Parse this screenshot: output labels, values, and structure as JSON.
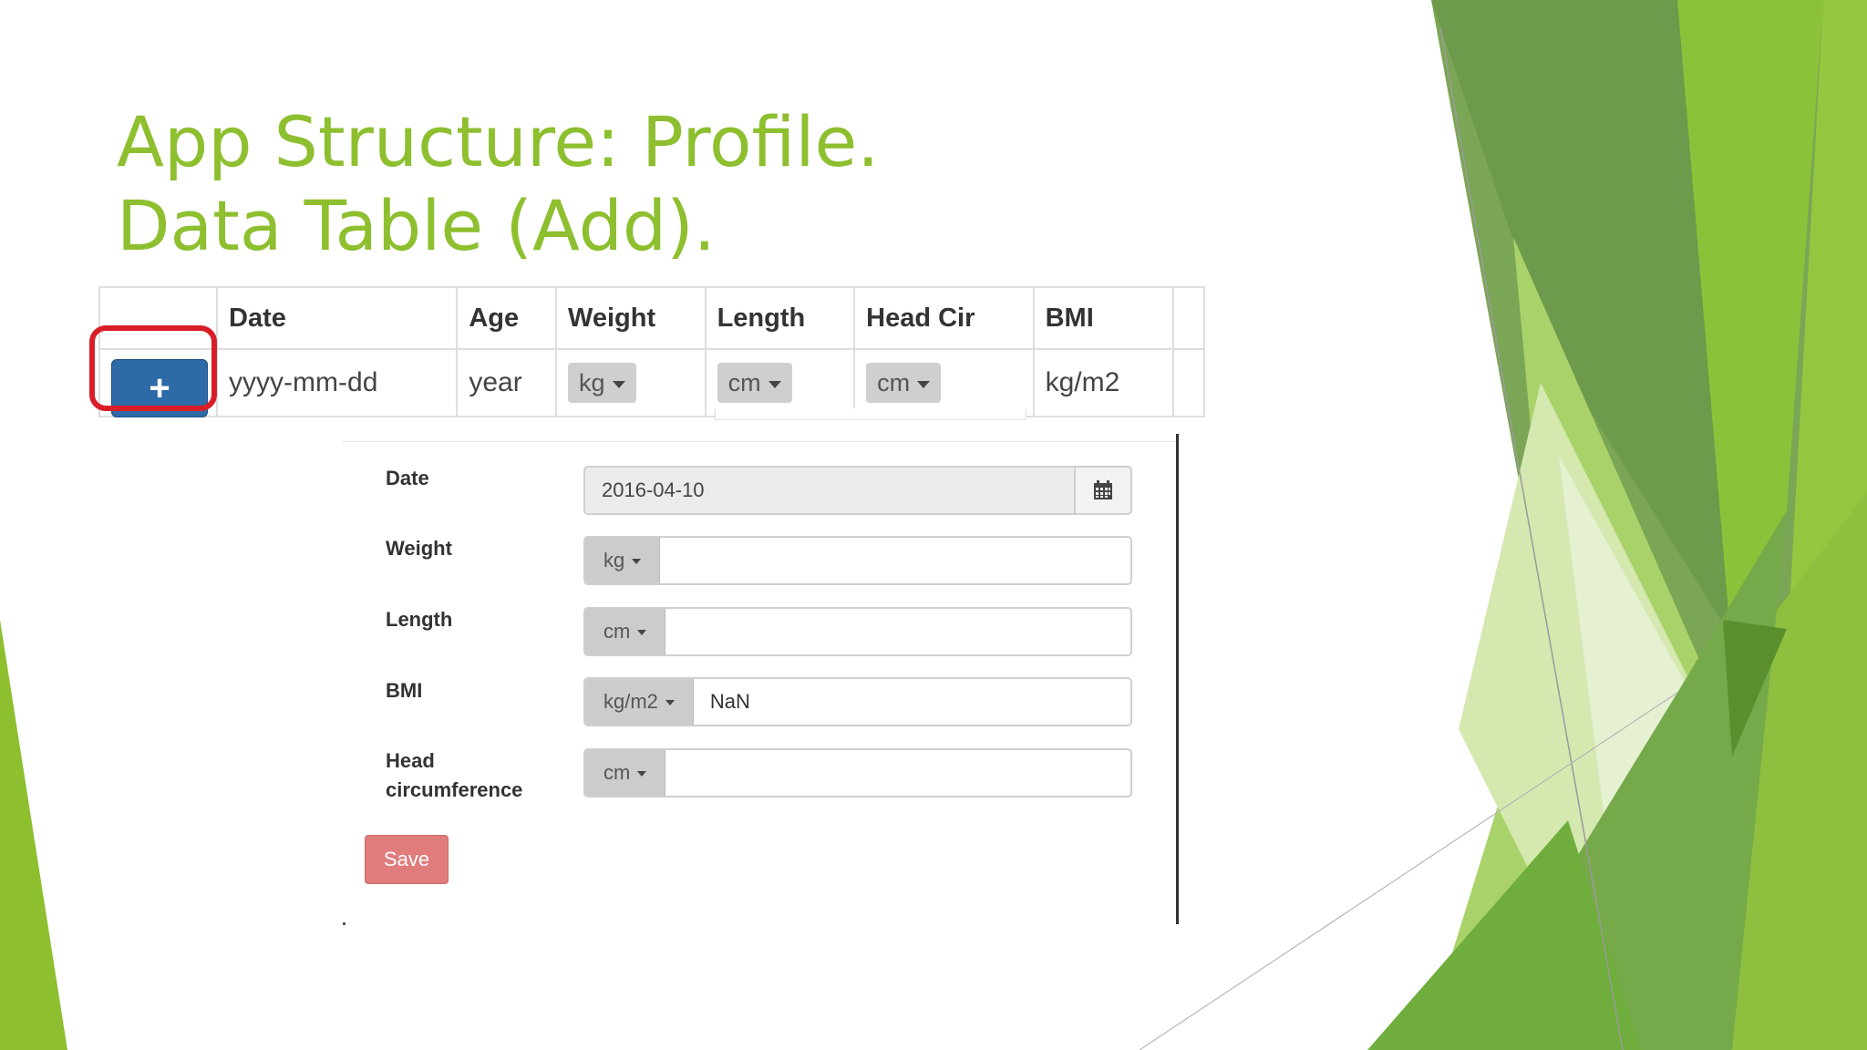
{
  "slide": {
    "title_line1": "App Structure: Profile.",
    "title_line2": "Data Table (Add).",
    "accent_color": "#8dbf2f",
    "highlight_color": "#d91e27"
  },
  "table": {
    "headers": [
      "",
      "Date",
      "Age",
      "Weight",
      "Length",
      "Head Cir",
      "BMI",
      ""
    ],
    "add_button_label": "+",
    "row": {
      "date_placeholder": "yyyy-mm-dd",
      "age_unit": "year",
      "weight_unit": "kg",
      "length_unit": "cm",
      "head_unit": "cm",
      "bmi_unit": "kg/m2"
    }
  },
  "form": {
    "date_label": "Date",
    "date_value": "2016-04-10",
    "calendar_icon": "calendar-icon",
    "weight_label": "Weight",
    "weight_unit": "kg",
    "weight_value": "",
    "length_label": "Length",
    "length_unit": "cm",
    "length_value": "",
    "bmi_label": "BMI",
    "bmi_unit": "kg/m2",
    "bmi_value": "NaN",
    "head_label_line1": "Head",
    "head_label_line2": "circumference",
    "head_unit": "cm",
    "head_value": "",
    "save_label": "Save",
    "save_color": "#e07c7c"
  }
}
